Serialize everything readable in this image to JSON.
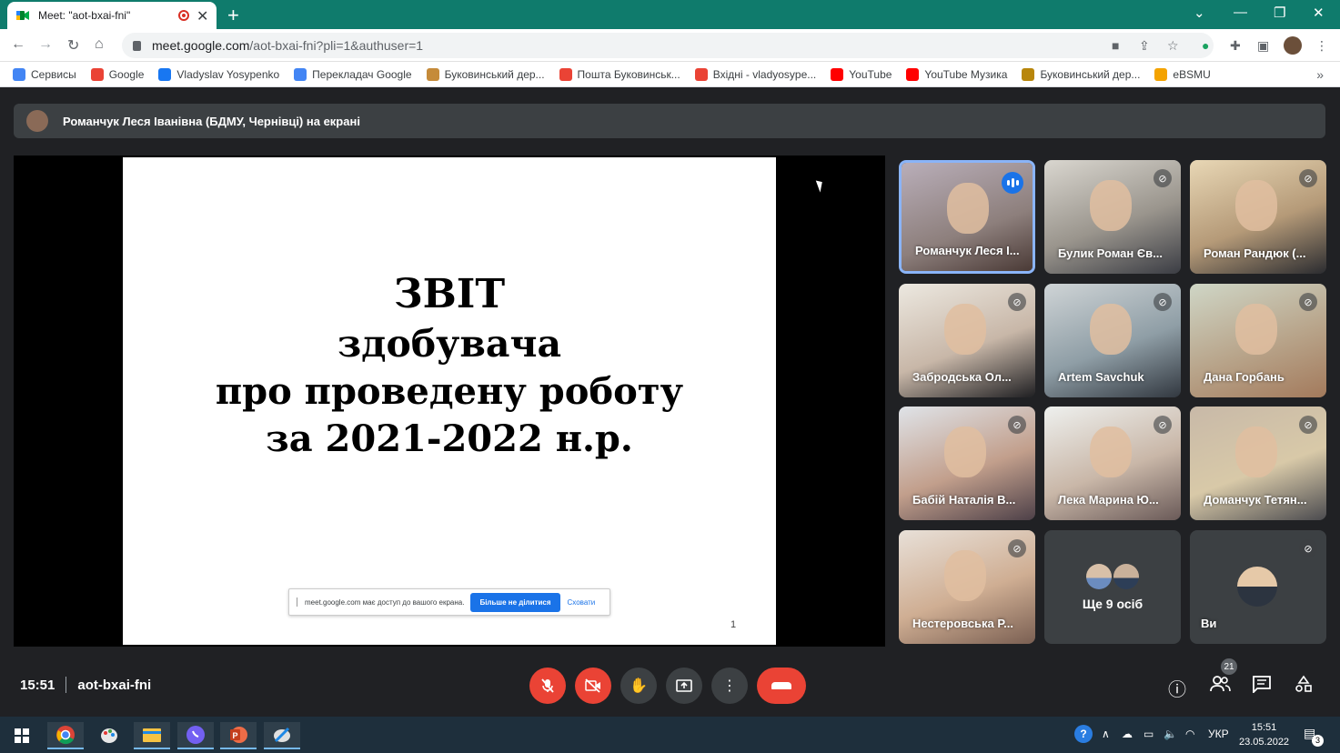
{
  "browser": {
    "tab_title": "Meet: \"aot-bxai-fni\"",
    "new_tab_label": "+",
    "url_host": "meet.google.com",
    "url_path": "/aot-bxai-fni?pli=1&authuser=1"
  },
  "bookmarks": [
    {
      "label": "Сервисы",
      "icon": "apps-grid-icon",
      "color": "#4285f4"
    },
    {
      "label": "Google",
      "icon": "google-icon",
      "color": "#ea4335"
    },
    {
      "label": "Vladyslav Yosypenko",
      "icon": "facebook-icon",
      "color": "#1877f2"
    },
    {
      "label": "Перекладач Google",
      "icon": "translate-icon",
      "color": "#4285f4"
    },
    {
      "label": "Буковинський дер...",
      "icon": "university-icon",
      "color": "#c58b3a"
    },
    {
      "label": "Пошта Буковинськ...",
      "icon": "gmail-icon",
      "color": "#ea4335"
    },
    {
      "label": "Вхідні - vladyosype...",
      "icon": "gmail-icon",
      "color": "#ea4335"
    },
    {
      "label": "YouTube",
      "icon": "youtube-icon",
      "color": "#ff0000"
    },
    {
      "label": "YouTube Музика",
      "icon": "youtube-music-icon",
      "color": "#ff0000"
    },
    {
      "label": "Буковинський дер...",
      "icon": "university-icon",
      "color": "#b8860b"
    },
    {
      "label": "eBSMU",
      "icon": "ebsmu-icon",
      "color": "#f4a300"
    }
  ],
  "meet": {
    "presenting_banner": "Романчук Леся Іванівна (БДМУ, Чернівці) на екрані",
    "slide": {
      "line1": "ЗВІТ",
      "line2": "здобувача",
      "line3": "про проведену роботу",
      "line4": "за 2021-2022 н.р.",
      "page_number": "1"
    },
    "share_notice": {
      "text": "meet.google.com має доступ до вашого екрана.",
      "stop_label": "Більше не ділитися",
      "hide_label": "Сховати"
    },
    "participants": [
      {
        "name": "Романчук Леся І...",
        "state": "speaking"
      },
      {
        "name": "Булик Роман Єв...",
        "state": "muted"
      },
      {
        "name": "Роман Рандюк (...",
        "state": "muted"
      },
      {
        "name": "Забродська Ол...",
        "state": "muted"
      },
      {
        "name": "Artem Savchuk",
        "state": "muted"
      },
      {
        "name": "Дана Горбань",
        "state": "muted"
      },
      {
        "name": "Бабій Наталія В...",
        "state": "muted"
      },
      {
        "name": "Лека Марина Ю...",
        "state": "muted"
      },
      {
        "name": "Доманчук Тетян...",
        "state": "muted"
      },
      {
        "name": "Нестеровська Р...",
        "state": "muted"
      }
    ],
    "more_participants": "Ще 9 осіб",
    "self_label": "Ви",
    "time": "15:51",
    "meeting_code": "aot-bxai-fni",
    "participants_count": "21"
  },
  "taskbar": {
    "clock_time": "15:51",
    "clock_date": "23.05.2022",
    "language": "УКР",
    "notifications": "3"
  }
}
